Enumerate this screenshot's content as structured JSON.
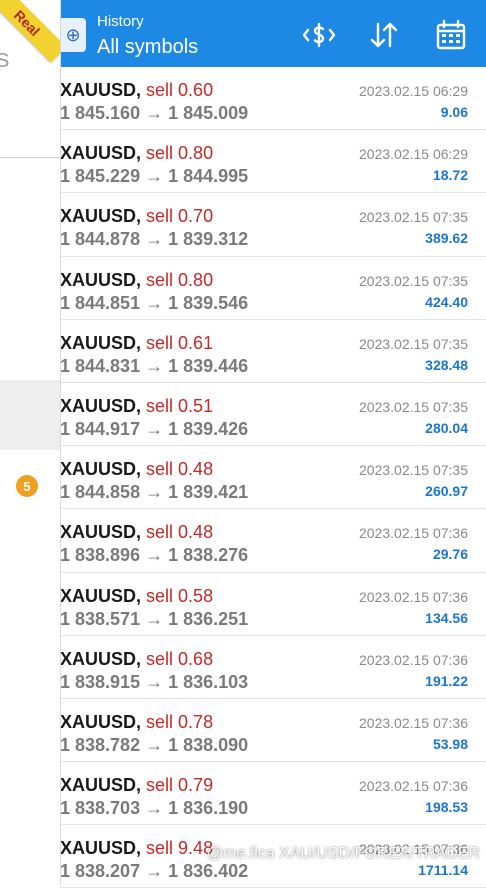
{
  "drawer": {
    "ribbon": "Real",
    "badge": "5",
    "partial_text": "S"
  },
  "header": {
    "subtitle": "History",
    "title": "All symbols"
  },
  "icons": {
    "app": "mt-app-icon",
    "swap": "dollar-swap-icon",
    "sort": "sort-icon",
    "calendar": "calendar-icon"
  },
  "trades": [
    {
      "symbol": "XAUUSD,",
      "action": "sell 0.60",
      "prices": "1 845.160 → 1 845.009",
      "date": "2023.02.15 06:29",
      "profit": "9.06"
    },
    {
      "symbol": "XAUUSD,",
      "action": "sell 0.80",
      "prices": "1 845.229 → 1 844.995",
      "date": "2023.02.15 06:29",
      "profit": "18.72"
    },
    {
      "symbol": "XAUUSD,",
      "action": "sell 0.70",
      "prices": "1 844.878 → 1 839.312",
      "date": "2023.02.15 07:35",
      "profit": "389.62"
    },
    {
      "symbol": "XAUUSD,",
      "action": "sell 0.80",
      "prices": "1 844.851 → 1 839.546",
      "date": "2023.02.15 07:35",
      "profit": "424.40"
    },
    {
      "symbol": "XAUUSD,",
      "action": "sell 0.61",
      "prices": "1 844.831 → 1 839.446",
      "date": "2023.02.15 07:35",
      "profit": "328.48"
    },
    {
      "symbol": "XAUUSD,",
      "action": "sell 0.51",
      "prices": "1 844.917 → 1 839.426",
      "date": "2023.02.15 07:35",
      "profit": "280.04"
    },
    {
      "symbol": "XAUUSD,",
      "action": "sell 0.48",
      "prices": "1 844.858 → 1 839.421",
      "date": "2023.02.15 07:35",
      "profit": "260.97"
    },
    {
      "symbol": "XAUUSD,",
      "action": "sell 0.48",
      "prices": "1 838.896 → 1 838.276",
      "date": "2023.02.15 07:36",
      "profit": "29.76"
    },
    {
      "symbol": "XAUUSD,",
      "action": "sell 0.58",
      "prices": "1 838.571 → 1 836.251",
      "date": "2023.02.15 07:36",
      "profit": "134.56"
    },
    {
      "symbol": "XAUUSD,",
      "action": "sell 0.68",
      "prices": "1 838.915 → 1 836.103",
      "date": "2023.02.15 07:36",
      "profit": "191.22"
    },
    {
      "symbol": "XAUUSD,",
      "action": "sell 0.78",
      "prices": "1 838.782 → 1 838.090",
      "date": "2023.02.15 07:36",
      "profit": "53.98"
    },
    {
      "symbol": "XAUUSD,",
      "action": "sell 0.79",
      "prices": "1 838.703 → 1 836.190",
      "date": "2023.02.15 07:36",
      "profit": "198.53"
    },
    {
      "symbol": "XAUUSD,",
      "action": "sell 9.48",
      "prices": "1 838.207 → 1 836.402",
      "date": "2023.02.15 07:36",
      "profit": "1711.14"
    }
  ],
  "watermark": "@me.fica XAU/USD/FOREX/TRADER",
  "colors": {
    "header": "#1e88e5",
    "sell": "#c62828",
    "profit": "#1976d2",
    "ribbon": "#f2d22e"
  }
}
